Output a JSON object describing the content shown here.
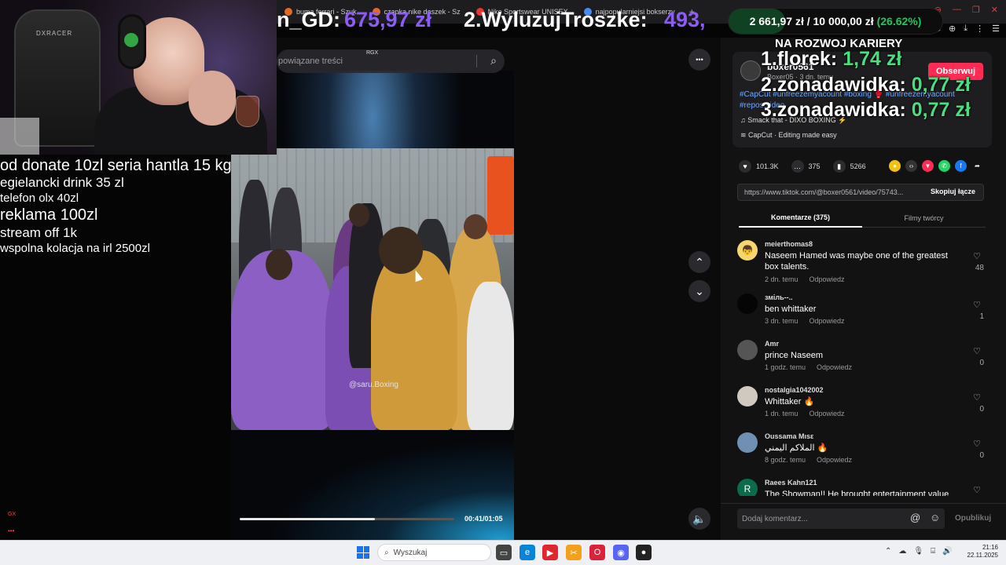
{
  "browser": {
    "tabs": [
      {
        "label": "buma ferrari - Szuk",
        "color": "#e06a2a"
      },
      {
        "label": "czapka nike daszek - Sz",
        "color": "#e06a2a"
      },
      {
        "label": "Nike Sportswear UNISEX",
        "color": "#e33"
      },
      {
        "label": "najpopularniejsi bokserzy",
        "color": "#4a8af4"
      }
    ],
    "new_tab": "+",
    "window_controls": [
      "⊖",
      "—",
      "❐",
      "✕"
    ],
    "toolbar_icons": [
      "⬡",
      "⊕",
      "⤓",
      "⋮",
      "☰"
    ]
  },
  "overlay": {
    "donor1_name": "n_GD:",
    "donor1_amount": "675,97 zł",
    "donor2_name": "2.WyluzujTroszke:",
    "donor2_amount": "493,",
    "goal_text": "2 661,97 zł / 10 000,00 zł",
    "goal_percent": "(26.62%)",
    "goal_fraction": 0.2662,
    "ranking_title": "NA ROZWOJ KARIERY",
    "ranking": [
      {
        "label": "1.florek:",
        "amount": "1,74 zł"
      },
      {
        "label": "2.zonadawidka:",
        "amount": "0,77 zł"
      },
      {
        "label": "3.zonadawidka:",
        "amount": "0,77 zł"
      }
    ],
    "rules": [
      {
        "text": "od donate 10zl seria hantla 15 kg",
        "size": "lg"
      },
      {
        "text": "egielancki drink 35 zl",
        "size": "md"
      },
      {
        "text": "telefon olx 40zl",
        "size": "sm"
      },
      {
        "text": "reklama 100zl",
        "size": "lg"
      },
      {
        "text": "stream off 1k",
        "size": "md"
      },
      {
        "text": "wspolna kolacja na irl 2500zl",
        "size": "sm"
      }
    ],
    "chair_label": "DXRACER",
    "gx": "GX",
    "dots": "•••"
  },
  "tiktok": {
    "search_placeholder": "powiązane treści",
    "rgx_badge": "RGX",
    "video_watermark": "@saru.Boxing",
    "progress_fraction": 0.63,
    "time": "00:41/01:05",
    "author": {
      "name": "boxer0561",
      "sub": "Boxer05 · 3 dn. temu",
      "follow": "Obserwuj"
    },
    "hashtags": "#CapCut #unfreezemyacount #boxing 🥊 #unfreezemyacount #repostvideo",
    "music": "Smack that - DIXO BOXING ⚡",
    "capcut": "CapCut · Editing made easy",
    "stats": {
      "likes": "101.3K",
      "comments": "375",
      "saves": "5266"
    },
    "url": "https://www.tiktok.com/@boxer0561/video/75743...",
    "copy_label": "Skopiuj łącze",
    "tab_comments": "Komentarze (375)",
    "tab_creator": "Filmy twórcy",
    "reply_label": "Odpowiedz",
    "comments": [
      {
        "user": "meierthomas8",
        "text": "Naseem Hamed was maybe one of the greatest box talents.",
        "time": "2 dn. temu",
        "likes": "48",
        "avatar": "👦",
        "avatar_color": "#f5d76e"
      },
      {
        "user": "зміль--..",
        "text": "ben whittaker",
        "time": "3 dn. temu",
        "likes": "1",
        "avatar": "",
        "avatar_color": "#050505"
      },
      {
        "user": "Amr",
        "text": "prince Naseem",
        "time": "1 godz. temu",
        "likes": "0",
        "avatar": "",
        "avatar_color": "#555"
      },
      {
        "user": "nostalgia1042002",
        "text": "Whittaker 🔥",
        "time": "1 dn. temu",
        "likes": "0",
        "avatar": "",
        "avatar_color": "#cfc9c0"
      },
      {
        "user": "Oussama Mısε",
        "text": "الملاكم اليمني 🔥",
        "time": "8 godz. temu",
        "likes": "0",
        "avatar": "",
        "avatar_color": "#6f8fb3"
      },
      {
        "user": "Raees Kahn121",
        "text": "The Showman!! He brought entertainment value",
        "time": "",
        "likes": "",
        "avatar": "R",
        "avatar_color": "#0b6b4a"
      }
    ],
    "comment_placeholder": "Dodaj komentarz...",
    "publish": "Opublikuj",
    "more_icon": "•••"
  },
  "taskbar": {
    "search_label": "Wyszukaj",
    "time": "21:16",
    "date": "22.11.2025"
  }
}
